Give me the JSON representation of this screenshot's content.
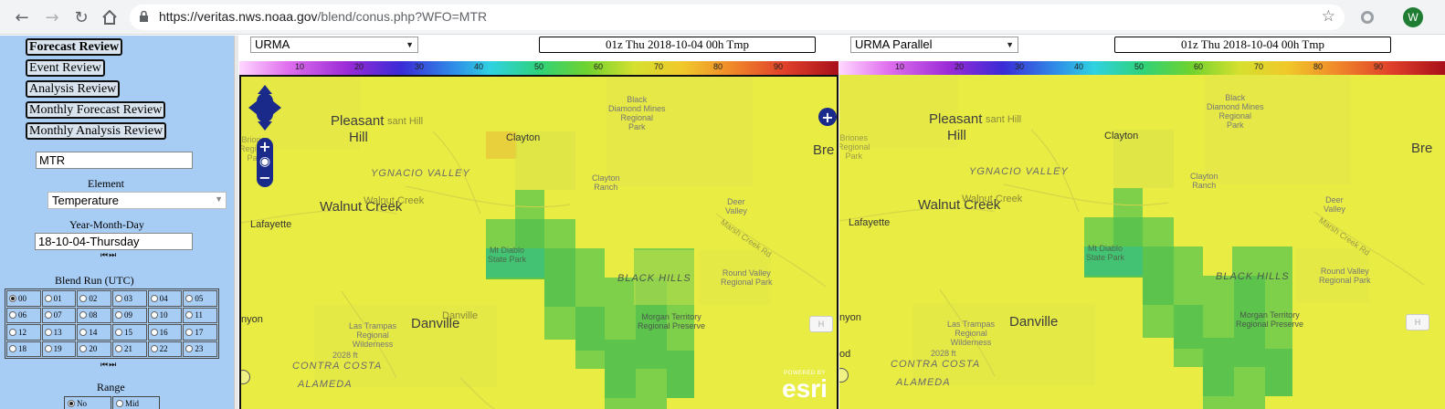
{
  "browser": {
    "url_host": "https://veritas.nws.noaa.gov",
    "url_path": "/blend/conus.php?WFO=MTR",
    "profile_initial": "W"
  },
  "sidebar": {
    "menu": [
      {
        "label": "Forecast Review",
        "active": true
      },
      {
        "label": "Event Review",
        "active": false
      },
      {
        "label": "Analysis Review",
        "active": false
      },
      {
        "label": "Monthly Forecast Review",
        "active": false
      },
      {
        "label": "Monthly Analysis Review",
        "active": false
      }
    ],
    "wfo_value": "MTR",
    "element_label": "Element",
    "element_value": "Temperature",
    "date_label": "Year-Month-Day",
    "date_value": "18-10-04-Thursday",
    "run_label": "Blend Run (UTC)",
    "runs": [
      "00",
      "01",
      "02",
      "03",
      "04",
      "05",
      "06",
      "07",
      "08",
      "09",
      "10",
      "11",
      "12",
      "13",
      "14",
      "15",
      "16",
      "17",
      "18",
      "19",
      "20",
      "21",
      "22",
      "23"
    ],
    "selected_run": "00",
    "range_label": "Range",
    "range_options": [
      "No",
      "Mid"
    ]
  },
  "left_pane": {
    "model": "URMA",
    "valid_time": "01z Thu 2018-10-04 00h Tmp"
  },
  "right_pane": {
    "model": "URMA Parallel",
    "valid_time": "01z Thu 2018-10-04 00h Tmp"
  },
  "colorbar": {
    "ticks": [
      "10",
      "20",
      "30",
      "40",
      "50",
      "60",
      "70",
      "80",
      "90"
    ]
  },
  "map_labels": {
    "pleasant": "Pleasant",
    "hill": "Hill",
    "pleasant_hill_faint": "sant Hill",
    "clayton": "Clayton",
    "walnut_creek": "Walnut Creek",
    "walnut_creek_faint": "Walnut Creek",
    "lafayette": "Lafayette",
    "ygnacio_valley": "YGNACIO VALLEY",
    "black_diamond_1": "Black",
    "black_diamond_2": "Diamond Mines",
    "black_diamond_3": "Regional",
    "black_diamond_4": "Park",
    "clayton_ranch_1": "Clayton",
    "clayton_ranch_2": "Ranch",
    "deer_valley_1": "Deer",
    "deer_valley_2": "Valley",
    "mt_diablo_1": "Mt Diablo",
    "mt_diablo_2": "State Park",
    "black_hills": "BLACK HILLS",
    "round_valley_1": "Round Valley",
    "round_valley_2": "Regional Park",
    "danville": "Danville",
    "danville_faint": "Danville",
    "morgan_1": "Morgan Territory",
    "morgan_2": "Regional Preserve",
    "las_trampas_1": "Las Trampas",
    "las_trampas_2": "Regional",
    "las_trampas_3": "Wilderness",
    "contra_costa": "CONTRA COSTA",
    "alameda": "ALAMEDA",
    "elev": "2028 ft",
    "canyon": "nyon",
    "bre": "Bre",
    "briones_1": "Briones",
    "briones_2": "Regional",
    "briones_3": "Park",
    "n_left": "n",
    "od": "od",
    "marsh_creek": "Marsh Creek Rd"
  },
  "esri": {
    "powered_by": "POWERED BY",
    "logo": "esri"
  },
  "h_button": "H"
}
